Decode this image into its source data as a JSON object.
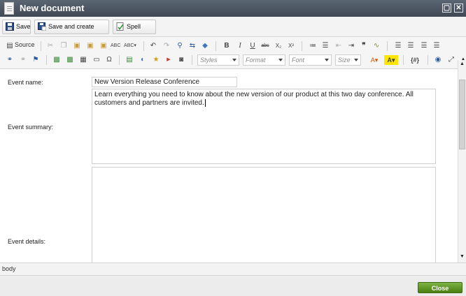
{
  "window": {
    "title": "New document"
  },
  "actions": {
    "save_label": "Save",
    "save_create_label": "Save and create another",
    "spell_label": "Spell check"
  },
  "toolbar": {
    "source_label": "Source",
    "bold_label": "B",
    "italic_label": "I",
    "underline_label": "U",
    "omega_label": "Ω",
    "styles_placeholder": "Styles",
    "format_placeholder": "Format",
    "font_placeholder": "Font",
    "size_placeholder": "Size",
    "source_code_label": "{#}"
  },
  "form": {
    "event_name_label": "Event name:",
    "event_name_value": "New Version Release Conference",
    "event_summary_label": "Event summary:",
    "event_summary_value": "Learn everything you need to know about the new version of our product at this two day conference. All customers and partners are invited.",
    "event_details_label": "Event details:"
  },
  "status": {
    "path": "body"
  },
  "footer": {
    "close_label": "Close"
  },
  "colors": {
    "title_bar": "#4b5560",
    "close_button": "#5e9a1e"
  }
}
